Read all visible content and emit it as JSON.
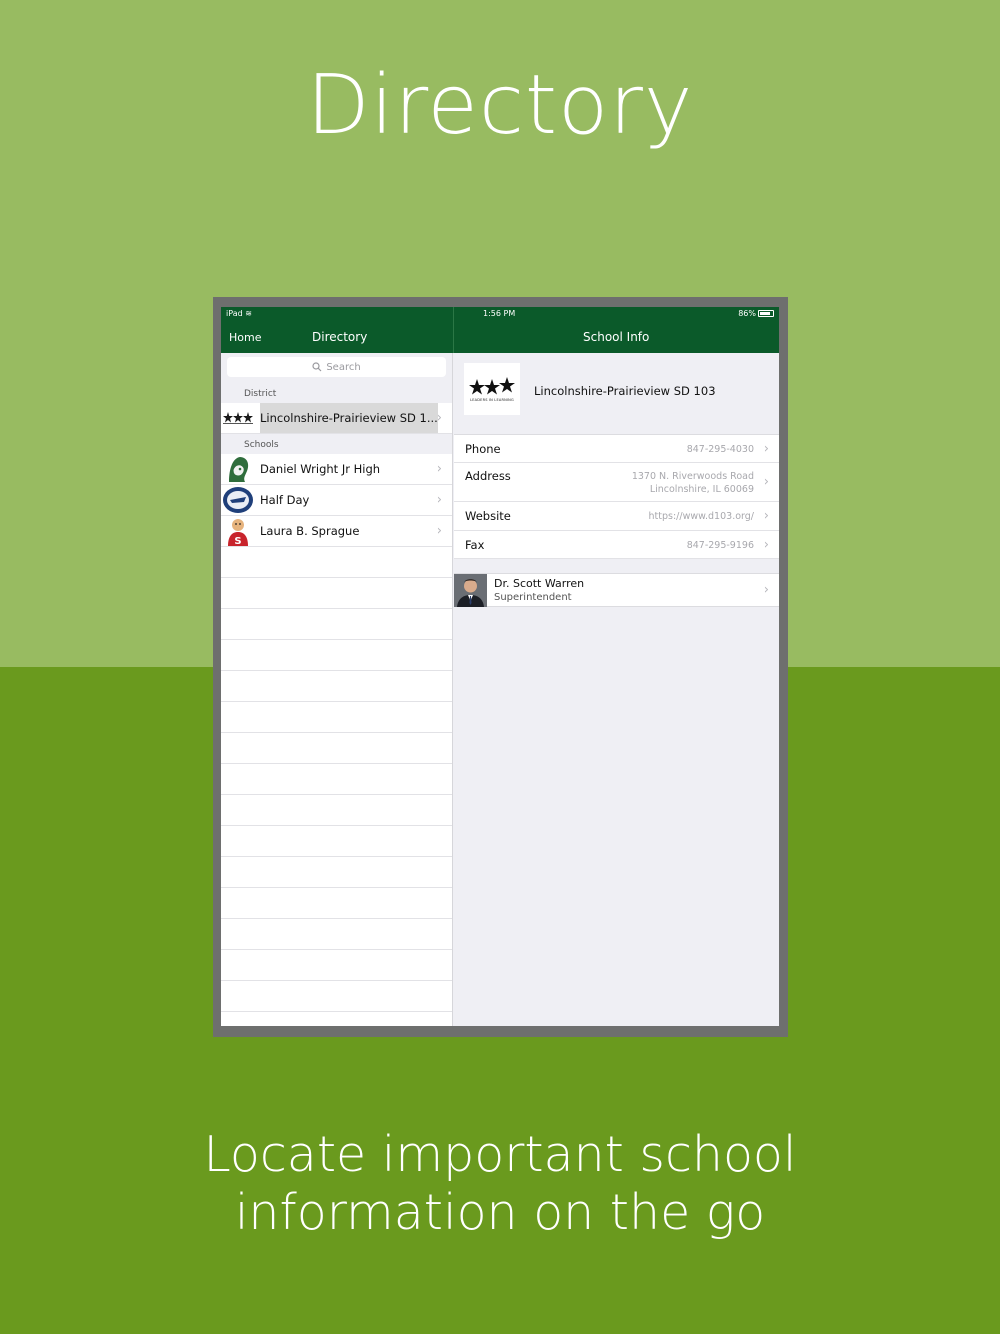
{
  "page": {
    "headline": "Directory",
    "caption_line1": "Locate important school",
    "caption_line2": "information on the go"
  },
  "status_bar": {
    "carrier": "iPad",
    "time": "1:56 PM",
    "battery": "86%",
    "battery_level": 0.86
  },
  "nav": {
    "back_label": "Home",
    "left_title": "Directory",
    "right_title": "School Info"
  },
  "search": {
    "placeholder": "Search"
  },
  "sections": {
    "district_label": "District",
    "schools_label": "Schools"
  },
  "district": {
    "name": "Lincolnshire-Prairieview SD 1..."
  },
  "schools": [
    {
      "name": "Daniel Wright Jr High"
    },
    {
      "name": "Half Day"
    },
    {
      "name": "Laura B. Sprague"
    }
  ],
  "school_info": {
    "name": "Lincolnshire-Prairieview SD 103",
    "logo_tagline": "LEADERS IN LEARNING",
    "phone_label": "Phone",
    "phone": "847-295-4030",
    "address_label": "Address",
    "address_line1": "1370 N. Riverwoods Road",
    "address_line2": "Lincolnshire, IL  60069",
    "website_label": "Website",
    "website": "https://www.d103.org/",
    "fax_label": "Fax",
    "fax": "847-295-9196"
  },
  "contact": {
    "name": "Dr. Scott Warren",
    "title": "Superintendent"
  },
  "colors": {
    "bg_top": "#98bb61",
    "bg_bottom": "#6a9a1e",
    "nav_green": "#0b5a2a"
  }
}
